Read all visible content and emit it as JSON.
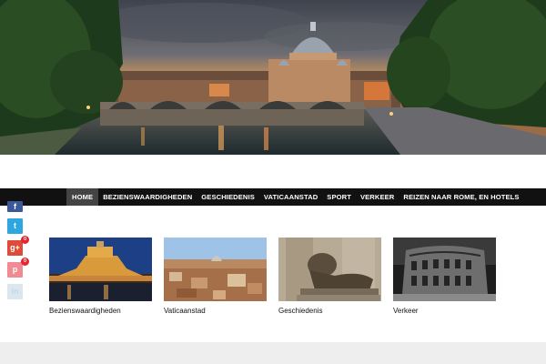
{
  "nav": {
    "items": [
      {
        "label": "HOME",
        "active": true
      },
      {
        "label": "BEZIENSWAARDIGHEDEN",
        "active": false
      },
      {
        "label": "GESCHIEDENIS",
        "active": false
      },
      {
        "label": "VATICAANSTAD",
        "active": false
      },
      {
        "label": "SPORT",
        "active": false
      },
      {
        "label": "VERKEER",
        "active": false
      },
      {
        "label": "REIZEN NAAR ROME, EN HOTELS",
        "active": false
      }
    ]
  },
  "social": {
    "facebook": {
      "glyph": "f",
      "icon": "facebook-icon",
      "color": "#3b5998"
    },
    "twitter": {
      "glyph": "t",
      "icon": "twitter-icon",
      "color": "#2ea7e0"
    },
    "googleplus": {
      "glyph": "g+",
      "icon": "google-plus-icon",
      "color": "#dd4b39",
      "count": "0"
    },
    "pinterest": {
      "glyph": "p",
      "icon": "pinterest-icon",
      "color": "#f28a94",
      "count": "0"
    },
    "linkedin": {
      "glyph": "in",
      "icon": "linkedin-icon",
      "color": "#dbe7ef"
    }
  },
  "cards": [
    {
      "title": "Bezienswaardigheden",
      "image": "castel-sant-angelo-night"
    },
    {
      "title": "Vaticaanstad",
      "image": "rome-rooftops-aerial"
    },
    {
      "title": "Geschiedenis",
      "image": "lion-statue"
    },
    {
      "title": "Verkeer",
      "image": "colosseum-black-white"
    }
  ],
  "colors": {
    "nav_bg": "#111111",
    "nav_active_bg": "#444444",
    "footer_bg": "#eeeeee"
  }
}
